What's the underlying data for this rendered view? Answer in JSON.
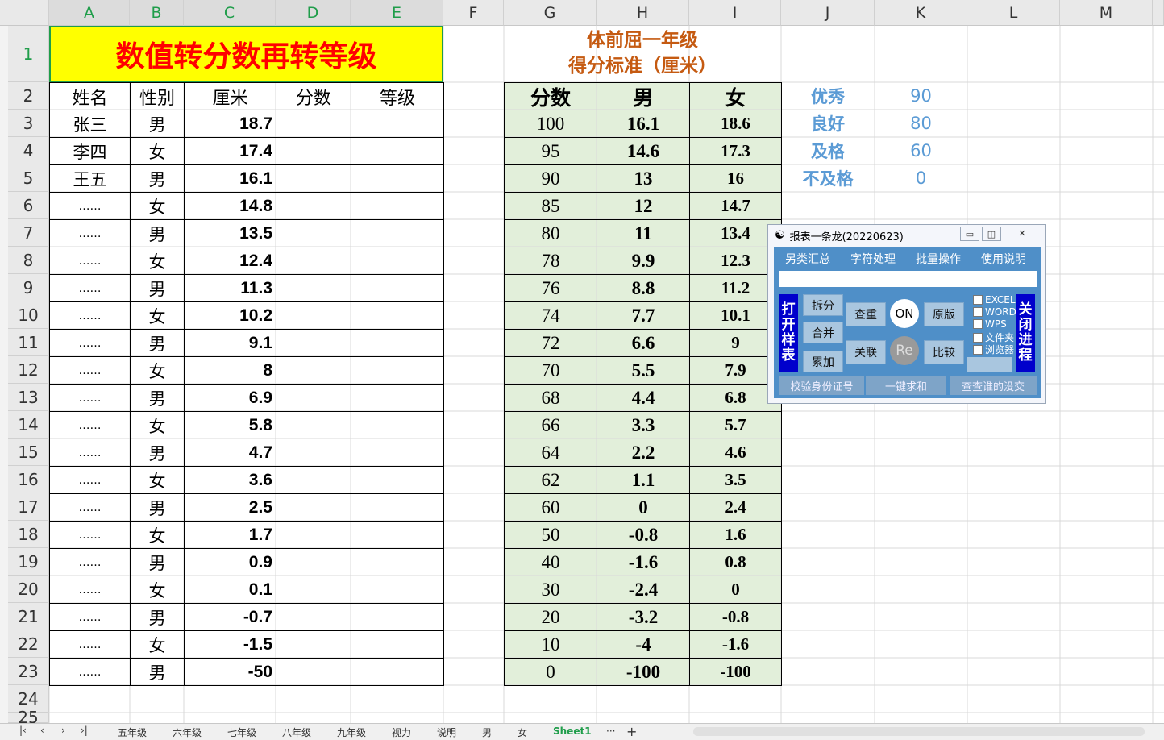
{
  "columns": [
    "A",
    "B",
    "C",
    "D",
    "E",
    "F",
    "G",
    "H",
    "I",
    "J",
    "K",
    "L",
    "M"
  ],
  "rows": [
    "1",
    "2",
    "3",
    "4",
    "5",
    "6",
    "7",
    "8",
    "9",
    "10",
    "11",
    "12",
    "13",
    "14",
    "15",
    "16",
    "17",
    "18",
    "19",
    "20",
    "21",
    "22",
    "23",
    "24",
    "25"
  ],
  "title": "数值转分数再转等级",
  "headers": {
    "name": "姓名",
    "gender": "性别",
    "cm": "厘米",
    "score": "分数",
    "grade": "等级"
  },
  "students": [
    {
      "name": "张三",
      "gender": "男",
      "cm": "18.7"
    },
    {
      "name": "李四",
      "gender": "女",
      "cm": "17.4"
    },
    {
      "name": "王五",
      "gender": "男",
      "cm": "16.1"
    },
    {
      "name": "……",
      "gender": "女",
      "cm": "14.8"
    },
    {
      "name": "……",
      "gender": "男",
      "cm": "13.5"
    },
    {
      "name": "……",
      "gender": "女",
      "cm": "12.4"
    },
    {
      "name": "……",
      "gender": "男",
      "cm": "11.3"
    },
    {
      "name": "……",
      "gender": "女",
      "cm": "10.2"
    },
    {
      "name": "……",
      "gender": "男",
      "cm": "9.1"
    },
    {
      "name": "……",
      "gender": "女",
      "cm": "8"
    },
    {
      "name": "……",
      "gender": "男",
      "cm": "6.9"
    },
    {
      "name": "……",
      "gender": "女",
      "cm": "5.8"
    },
    {
      "name": "……",
      "gender": "男",
      "cm": "4.7"
    },
    {
      "name": "……",
      "gender": "女",
      "cm": "3.6"
    },
    {
      "name": "……",
      "gender": "男",
      "cm": "2.5"
    },
    {
      "name": "……",
      "gender": "女",
      "cm": "1.7"
    },
    {
      "name": "……",
      "gender": "男",
      "cm": "0.9"
    },
    {
      "name": "……",
      "gender": "女",
      "cm": "0.1"
    },
    {
      "name": "……",
      "gender": "男",
      "cm": "-0.7"
    },
    {
      "name": "……",
      "gender": "女",
      "cm": "-1.5"
    },
    {
      "name": "……",
      "gender": "男",
      "cm": "-50"
    }
  ],
  "standard": {
    "title_line1": "体前屈一年级",
    "title_line2": "得分标准（厘米）",
    "headers": {
      "score": "分数",
      "male": "男",
      "female": "女"
    },
    "rows": [
      {
        "score": "100",
        "male": "16.1",
        "female": "18.6"
      },
      {
        "score": "95",
        "male": "14.6",
        "female": "17.3"
      },
      {
        "score": "90",
        "male": "13",
        "female": "16"
      },
      {
        "score": "85",
        "male": "12",
        "female": "14.7"
      },
      {
        "score": "80",
        "male": "11",
        "female": "13.4"
      },
      {
        "score": "78",
        "male": "9.9",
        "female": "12.3"
      },
      {
        "score": "76",
        "male": "8.8",
        "female": "11.2"
      },
      {
        "score": "74",
        "male": "7.7",
        "female": "10.1"
      },
      {
        "score": "72",
        "male": "6.6",
        "female": "9"
      },
      {
        "score": "70",
        "male": "5.5",
        "female": "7.9"
      },
      {
        "score": "68",
        "male": "4.4",
        "female": "6.8"
      },
      {
        "score": "66",
        "male": "3.3",
        "female": "5.7"
      },
      {
        "score": "64",
        "male": "2.2",
        "female": "4.6"
      },
      {
        "score": "62",
        "male": "1.1",
        "female": "3.5"
      },
      {
        "score": "60",
        "male": "0",
        "female": "2.4"
      },
      {
        "score": "50",
        "male": "-0.8",
        "female": "1.6"
      },
      {
        "score": "40",
        "male": "-1.6",
        "female": "0.8"
      },
      {
        "score": "30",
        "male": "-2.4",
        "female": "0"
      },
      {
        "score": "20",
        "male": "-3.2",
        "female": "-0.8"
      },
      {
        "score": "10",
        "male": "-4",
        "female": "-1.6"
      },
      {
        "score": "0",
        "male": "-100",
        "female": "-100"
      }
    ]
  },
  "levels": [
    {
      "label": "优秀",
      "value": "90"
    },
    {
      "label": "良好",
      "value": "80"
    },
    {
      "label": "及格",
      "value": "60"
    },
    {
      "label": "不及格",
      "value": "0"
    }
  ],
  "popup": {
    "title": "报表一条龙(20220623)",
    "menu": [
      "另类汇总",
      "字符处理",
      "批量操作",
      "使用说明"
    ],
    "left_vertical": "打开样表",
    "right_vertical": "关闭进程",
    "buttons": {
      "split": "拆分",
      "merge": "合并",
      "accumulate": "累加",
      "dedupe": "查重",
      "relate": "关联",
      "on": "ON",
      "re": "Re",
      "original": "原版",
      "compare": "比较"
    },
    "checks": [
      "EXCEL",
      "WORD",
      "WPS",
      "文件夹",
      "浏览器"
    ],
    "bottom": [
      "校验身份证号",
      "一键求和",
      "查查谁的没交"
    ]
  },
  "tabs": [
    "五年级",
    "六年级",
    "七年级",
    "八年级",
    "九年级",
    "视力",
    "说明",
    "男",
    "女",
    "Sheet1"
  ],
  "active_tab": "Sheet1",
  "tab_more": "···",
  "tab_add": "+",
  "colors": {
    "header_green": "#1f9d4a",
    "title_red": "#ff0000",
    "title_bg": "#ffff00",
    "std_bg": "#e2efda",
    "std_title": "#c55a11",
    "level_blue": "#5b9bd5",
    "popup_blue": "#4f8fc8"
  }
}
